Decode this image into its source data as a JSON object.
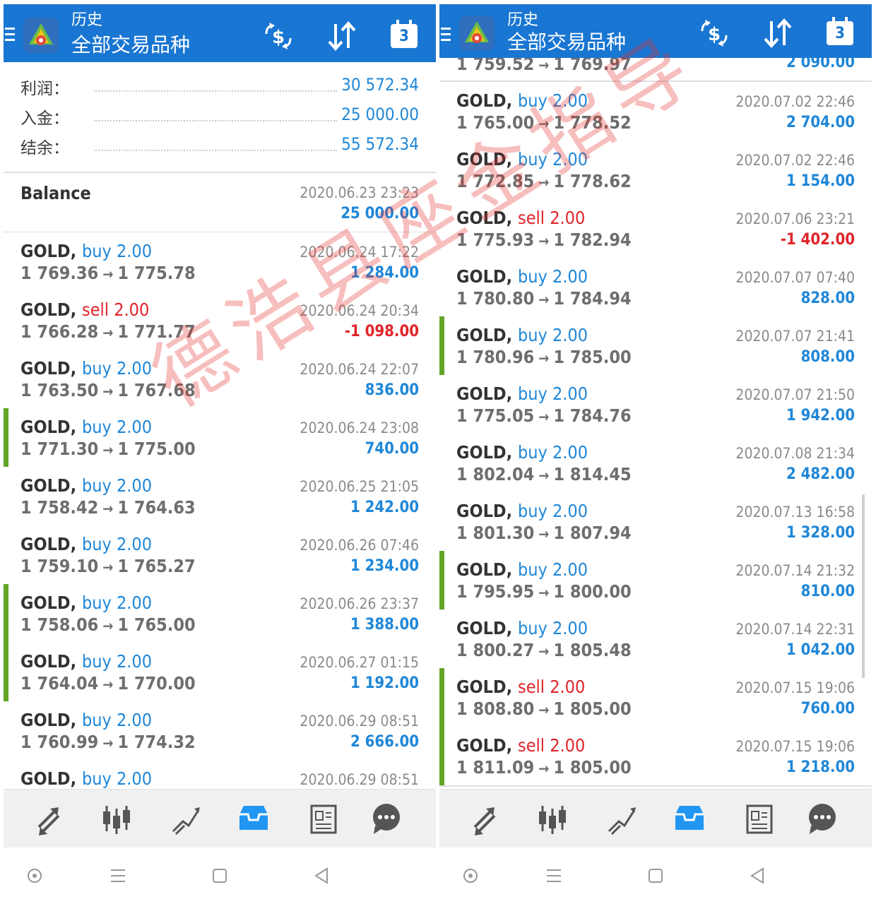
{
  "header": {
    "title": "历史",
    "subtitle": "全部交易品种",
    "calendar_day": "3"
  },
  "summary": {
    "profit_label": "利润：",
    "profit_value": "30 572.34",
    "deposit_label": "入金：",
    "deposit_value": "25 000.00",
    "balance_label": "结余：",
    "balance_value": "55 572.34"
  },
  "balance_entry": {
    "label": "Balance",
    "time": "2020.06.23 23:23",
    "amount": "25 000.00"
  },
  "left_trades": [
    {
      "symbol": "GOLD",
      "side": "buy",
      "volume": "2.00",
      "open": "1 769.36",
      "close": "1 775.78",
      "time": "2020.06.24 17:22",
      "profit": "1 284.00",
      "marked": false
    },
    {
      "symbol": "GOLD",
      "side": "sell",
      "volume": "2.00",
      "open": "1 766.28",
      "close": "1 771.77",
      "time": "2020.06.24 20:34",
      "profit": "-1 098.00",
      "marked": false
    },
    {
      "symbol": "GOLD",
      "side": "buy",
      "volume": "2.00",
      "open": "1 763.50",
      "close": "1 767.68",
      "time": "2020.06.24 22:07",
      "profit": "836.00",
      "marked": false
    },
    {
      "symbol": "GOLD",
      "side": "buy",
      "volume": "2.00",
      "open": "1 771.30",
      "close": "1 775.00",
      "time": "2020.06.24 23:08",
      "profit": "740.00",
      "marked": true
    },
    {
      "symbol": "GOLD",
      "side": "buy",
      "volume": "2.00",
      "open": "1 758.42",
      "close": "1 764.63",
      "time": "2020.06.25 21:05",
      "profit": "1 242.00",
      "marked": false
    },
    {
      "symbol": "GOLD",
      "side": "buy",
      "volume": "2.00",
      "open": "1 759.10",
      "close": "1 765.27",
      "time": "2020.06.26 07:46",
      "profit": "1 234.00",
      "marked": false
    },
    {
      "symbol": "GOLD",
      "side": "buy",
      "volume": "2.00",
      "open": "1 758.06",
      "close": "1 765.00",
      "time": "2020.06.26 23:37",
      "profit": "1 388.00",
      "marked": true
    },
    {
      "symbol": "GOLD",
      "side": "buy",
      "volume": "2.00",
      "open": "1 764.04",
      "close": "1 770.00",
      "time": "2020.06.27 01:15",
      "profit": "1 192.00",
      "marked": true
    },
    {
      "symbol": "GOLD",
      "side": "buy",
      "volume": "2.00",
      "open": "1 760.99",
      "close": "1 774.32",
      "time": "2020.06.29 08:51",
      "profit": "2 666.00",
      "marked": false
    },
    {
      "symbol": "GOLD",
      "side": "buy",
      "volume": "2.00",
      "open": "",
      "close": "",
      "time": "2020.06.29 08:51",
      "profit": "",
      "marked": false
    }
  ],
  "right_partial": {
    "open": "1 759.52",
    "close": "1 769.97",
    "profit": "2 090.00"
  },
  "right_trades": [
    {
      "symbol": "GOLD",
      "side": "buy",
      "volume": "2.00",
      "open": "1 765.00",
      "close": "1 778.52",
      "time": "2020.07.02 22:46",
      "profit": "2 704.00",
      "marked": false
    },
    {
      "symbol": "GOLD",
      "side": "buy",
      "volume": "2.00",
      "open": "1 772.85",
      "close": "1 778.62",
      "time": "2020.07.02 22:46",
      "profit": "1 154.00",
      "marked": false
    },
    {
      "symbol": "GOLD",
      "side": "sell",
      "volume": "2.00",
      "open": "1 775.93",
      "close": "1 782.94",
      "time": "2020.07.06 23:21",
      "profit": "-1 402.00",
      "marked": false
    },
    {
      "symbol": "GOLD",
      "side": "buy",
      "volume": "2.00",
      "open": "1 780.80",
      "close": "1 784.94",
      "time": "2020.07.07 07:40",
      "profit": "828.00",
      "marked": false
    },
    {
      "symbol": "GOLD",
      "side": "buy",
      "volume": "2.00",
      "open": "1 780.96",
      "close": "1 785.00",
      "time": "2020.07.07 21:41",
      "profit": "808.00",
      "marked": true
    },
    {
      "symbol": "GOLD",
      "side": "buy",
      "volume": "2.00",
      "open": "1 775.05",
      "close": "1 784.76",
      "time": "2020.07.07 21:50",
      "profit": "1 942.00",
      "marked": false
    },
    {
      "symbol": "GOLD",
      "side": "buy",
      "volume": "2.00",
      "open": "1 802.04",
      "close": "1 814.45",
      "time": "2020.07.08 21:34",
      "profit": "2 482.00",
      "marked": false
    },
    {
      "symbol": "GOLD",
      "side": "buy",
      "volume": "2.00",
      "open": "1 801.30",
      "close": "1 807.94",
      "time": "2020.07.13 16:58",
      "profit": "1 328.00",
      "marked": false
    },
    {
      "symbol": "GOLD",
      "side": "buy",
      "volume": "2.00",
      "open": "1 795.95",
      "close": "1 800.00",
      "time": "2020.07.14 21:32",
      "profit": "810.00",
      "marked": true
    },
    {
      "symbol": "GOLD",
      "side": "buy",
      "volume": "2.00",
      "open": "1 800.27",
      "close": "1 805.48",
      "time": "2020.07.14 22:31",
      "profit": "1 042.00",
      "marked": false
    },
    {
      "symbol": "GOLD",
      "side": "sell",
      "volume": "2.00",
      "open": "1 808.80",
      "close": "1 805.00",
      "time": "2020.07.15 19:06",
      "profit": "760.00",
      "marked": true
    },
    {
      "symbol": "GOLD",
      "side": "sell",
      "volume": "2.00",
      "open": "1 811.09",
      "close": "1 805.00",
      "time": "2020.07.15 19:06",
      "profit": "1 218.00",
      "marked": true
    }
  ],
  "arrow_glyph": "→",
  "watermark": "德浩县座金指导",
  "icons": {
    "header": [
      "currency-exchange-icon",
      "sort-icon",
      "calendar-icon"
    ],
    "bottom_nav": [
      "quotes-icon",
      "chart-icon",
      "trade-icon",
      "history-icon",
      "news-icon",
      "chat-icon"
    ],
    "system_nav": [
      "circle-icon",
      "menu-icon",
      "square-icon",
      "back-icon"
    ]
  },
  "colors": {
    "header_bg": "#1976d2",
    "buy": "#1f87d8",
    "sell": "#e0242a",
    "marker": "#62a527",
    "watermark": "#e42828"
  }
}
